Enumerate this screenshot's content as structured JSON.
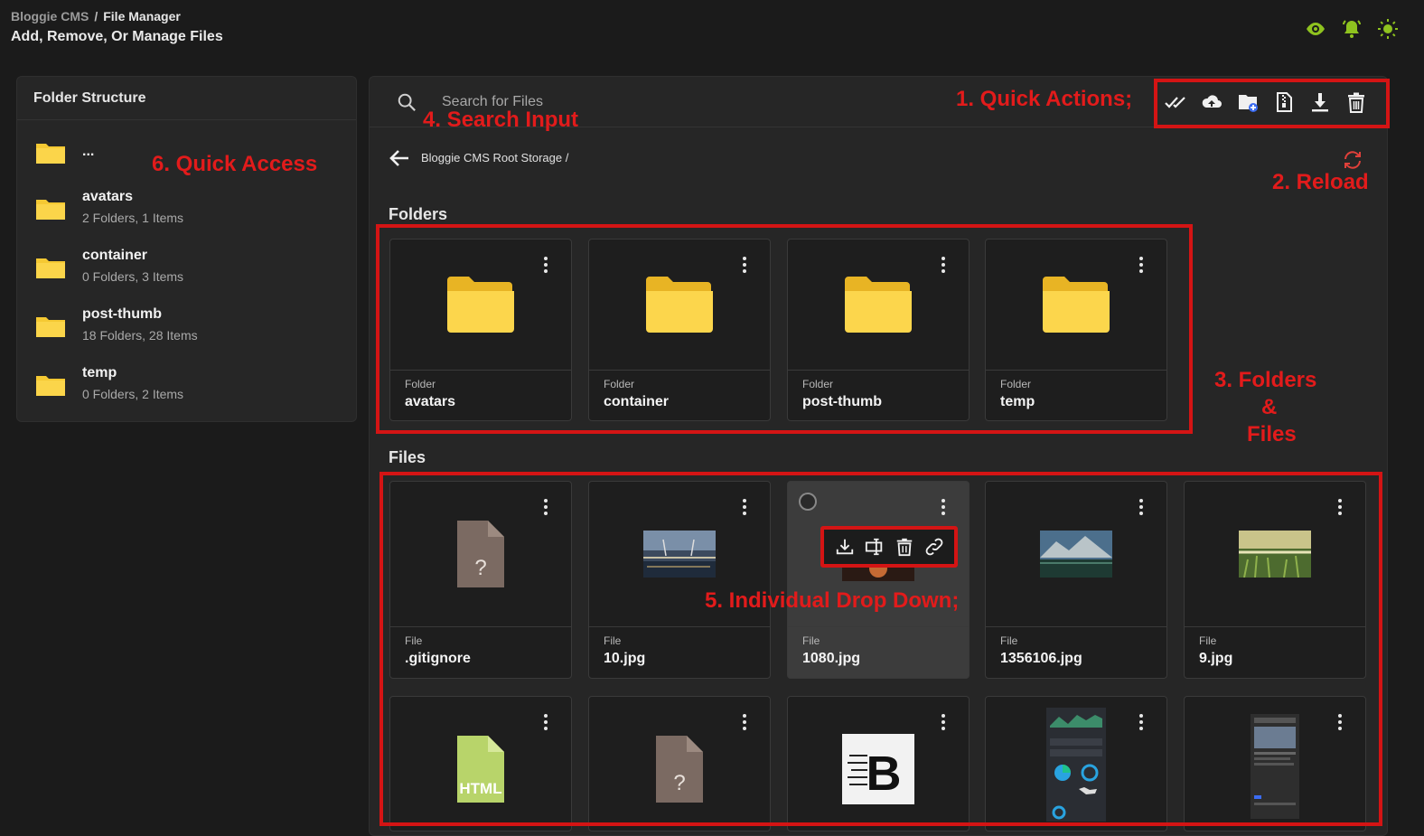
{
  "header": {
    "app_name": "Bloggie CMS",
    "separator": "/",
    "page_name": "File Manager",
    "subtitle": "Add, Remove, Or Manage Files"
  },
  "top_icons": [
    "eye-icon",
    "bell-icon",
    "sun-icon"
  ],
  "colors": {
    "accent_green": "#8fc31f",
    "annotation_red": "#d41414",
    "folder_yellow": "#f5c933"
  },
  "sidebar": {
    "title": "Folder Structure",
    "items": [
      {
        "name": "...",
        "meta": ""
      },
      {
        "name": "avatars",
        "meta": "2 Folders, 1 Items"
      },
      {
        "name": "container",
        "meta": "0 Folders, 3 Items"
      },
      {
        "name": "post-thumb",
        "meta": "18 Folders, 28 Items"
      },
      {
        "name": "temp",
        "meta": "0 Folders, 2 Items"
      }
    ]
  },
  "search": {
    "placeholder": "Search for Files"
  },
  "quick_actions": [
    "select-all-icon",
    "upload-icon",
    "new-folder-icon",
    "zip-icon",
    "download-icon",
    "delete-icon"
  ],
  "breadcrumb_path": "Bloggie CMS Root Storage /",
  "sections": {
    "folders": "Folders",
    "files": "Files"
  },
  "folders": [
    {
      "kind": "Folder",
      "name": "avatars"
    },
    {
      "kind": "Folder",
      "name": "container"
    },
    {
      "kind": "Folder",
      "name": "post-thumb"
    },
    {
      "kind": "Folder",
      "name": "temp"
    }
  ],
  "files": [
    {
      "kind": "File",
      "name": ".gitignore",
      "thumb": "unknown"
    },
    {
      "kind": "File",
      "name": "10.jpg",
      "thumb": "bridge-photo"
    },
    {
      "kind": "File",
      "name": "1080.jpg",
      "thumb": "dark-photo"
    },
    {
      "kind": "File",
      "name": "1356106.jpg",
      "thumb": "lake-photo"
    },
    {
      "kind": "File",
      "name": "9.jpg",
      "thumb": "grass-photo"
    }
  ],
  "files_row2": [
    {
      "thumb": "html",
      "label": "HTML"
    },
    {
      "thumb": "unknown",
      "label": "?"
    },
    {
      "thumb": "logo",
      "label": "B"
    },
    {
      "thumb": "dashboard-screenshot"
    },
    {
      "thumb": "page-screenshot"
    }
  ],
  "unknown_file_glyph": "?",
  "dropdown_actions": [
    "download-icon",
    "rename-icon",
    "delete-icon",
    "link-icon"
  ],
  "annotations": {
    "quick_actions": "1. Quick Actions;",
    "reload": "2. Reload",
    "folders_files_line1": "3. Folders",
    "folders_files_line2": "&",
    "folders_files_line3": "Files",
    "search": "4. Search Input",
    "dropdown": "5. Individual Drop Down;",
    "quick_access": "6. Quick Access"
  }
}
